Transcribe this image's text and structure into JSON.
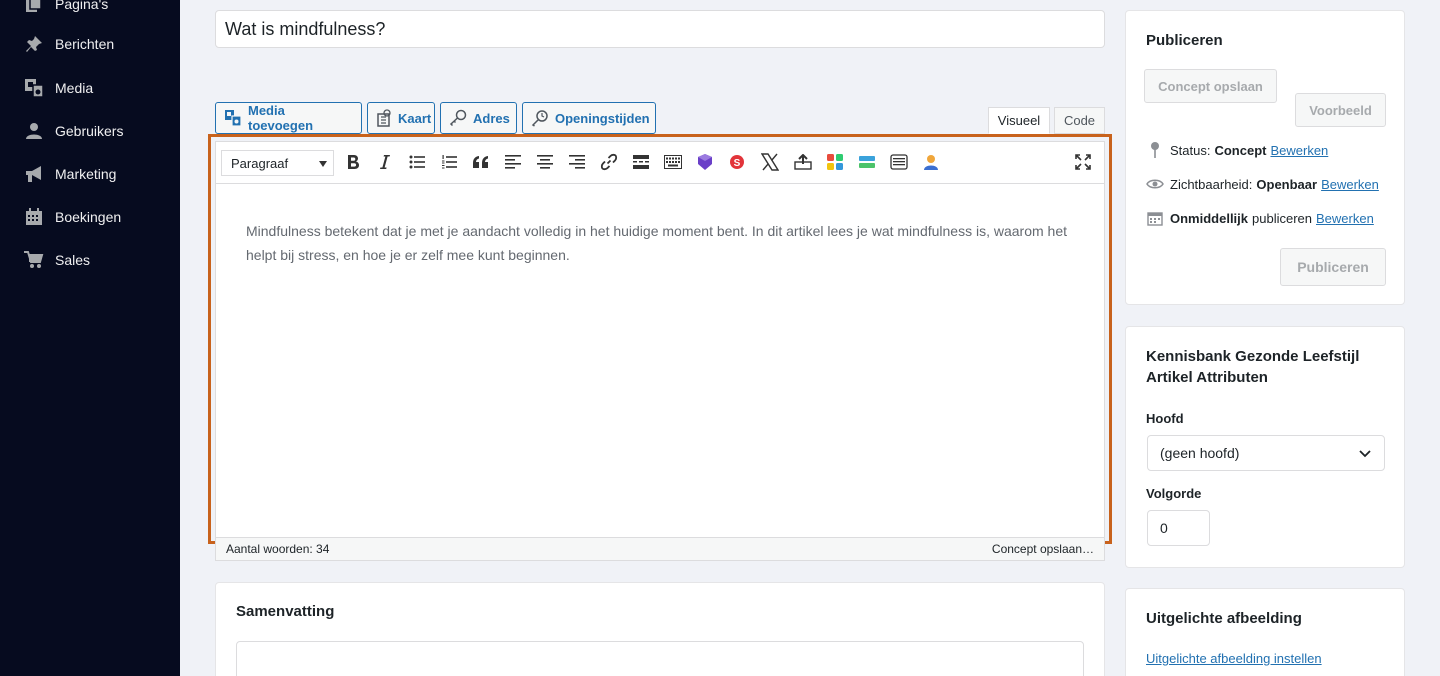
{
  "sidebar": {
    "items": [
      {
        "label": "Pagina's",
        "icon": "pages-icon"
      },
      {
        "label": "Berichten",
        "icon": "pin-icon"
      },
      {
        "label": "Media",
        "icon": "media-icon"
      },
      {
        "label": "Gebruikers",
        "icon": "user-icon"
      },
      {
        "label": "Marketing",
        "icon": "megaphone-icon"
      },
      {
        "label": "Boekingen",
        "icon": "calendar-icon"
      },
      {
        "label": "Sales",
        "icon": "cart-icon"
      }
    ]
  },
  "post": {
    "title": "Wat is mindfulness?"
  },
  "media_buttons": [
    {
      "label": "Media toevoegen",
      "icon": "add-media-icon"
    },
    {
      "label": "Kaart",
      "icon": "map-icon"
    },
    {
      "label": "Adres",
      "icon": "address-icon"
    },
    {
      "label": "Openingstijden",
      "icon": "clock-icon"
    }
  ],
  "editor_tabs": {
    "visual": "Visueel",
    "code": "Code"
  },
  "editor": {
    "format": "Paragraaf",
    "content": "Mindfulness betekent dat je met je aandacht volledig in het huidige moment bent. In dit artikel lees je wat mindfulness is, waarom het helpt bij stress, en hoe je er zelf mee kunt beginnen.",
    "word_count": "Aantal woorden: 34",
    "autosave_status": "Concept opslaan…",
    "toolbar_icons": [
      "bold-icon",
      "italic-icon",
      "bullet-list-icon",
      "numbered-list-icon",
      "blockquote-icon",
      "align-left-icon",
      "align-center-icon",
      "align-right-icon",
      "link-icon",
      "read-more-icon",
      "toolbar-toggle-icon",
      "shield-plugin-icon",
      "s-plugin-icon",
      "x-icon",
      "upload-icon",
      "grid-plugin-icon",
      "bar-plugin-icon",
      "list-plugin-icon",
      "person-plugin-icon",
      "fullscreen-icon"
    ]
  },
  "summary": {
    "heading": "Samenvatting"
  },
  "publish": {
    "heading": "Publiceren",
    "save_draft": "Concept opslaan",
    "preview": "Voorbeeld",
    "status_label": "Status:",
    "status_value": "Concept",
    "visibility_label": "Zichtbaarheid:",
    "visibility_value": "Openbaar",
    "schedule_value": "Onmiddellijk",
    "schedule_label": "publiceren",
    "edit": "Bewerken",
    "publish_button": "Publiceren"
  },
  "attributes": {
    "heading": "Kennisbank Gezonde Leefstijl Artikel Attributen",
    "parent_label": "Hoofd",
    "parent_value": "(geen hoofd)",
    "order_label": "Volgorde",
    "order_value": "0"
  },
  "featured_image": {
    "heading": "Uitgelichte afbeelding",
    "set_link": "Uitgelichte afbeelding instellen"
  }
}
